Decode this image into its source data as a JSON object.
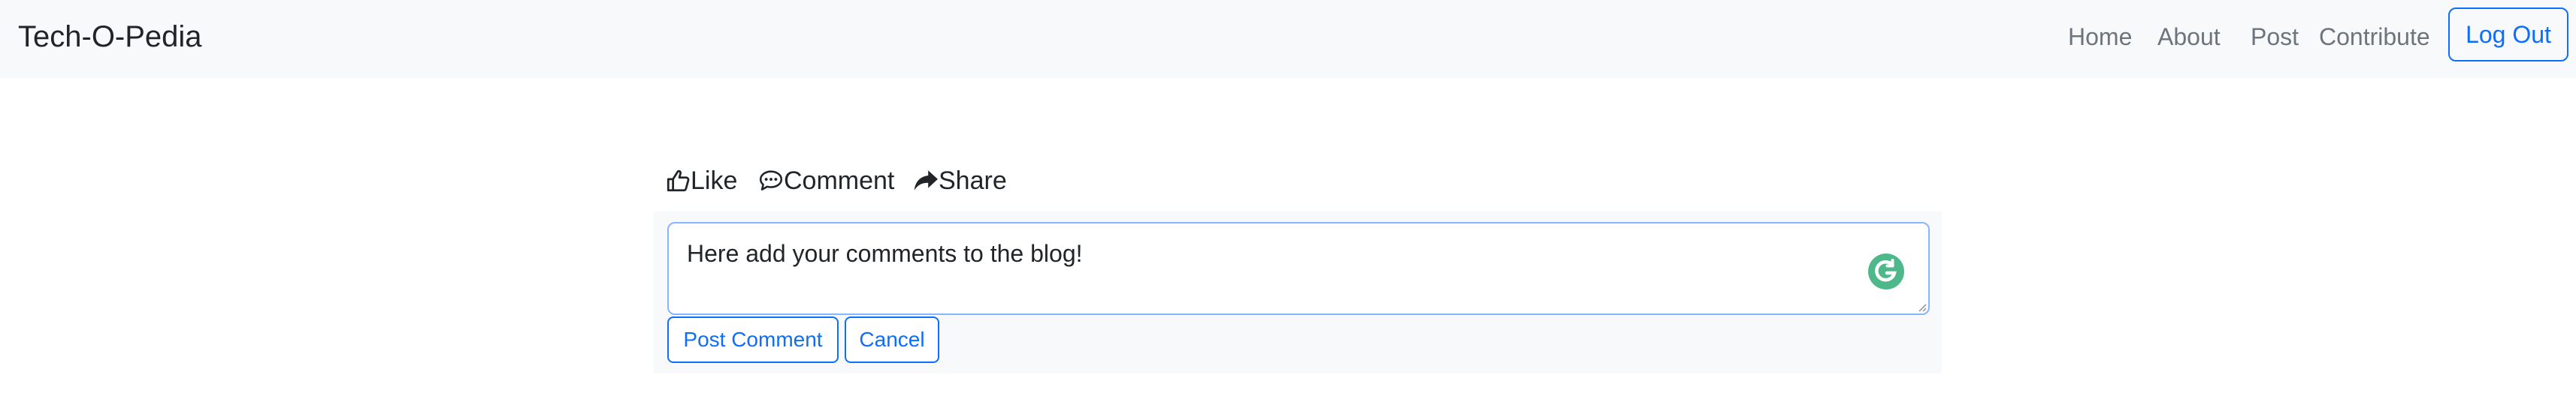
{
  "navbar": {
    "brand": "Tech-O-Pedia",
    "links": [
      "Home",
      "About",
      "Post",
      "Contribute"
    ],
    "logout_label": "Log Out"
  },
  "post_actions": {
    "like": {
      "label": "Like",
      "icon": "thumbs-up-icon"
    },
    "comment": {
      "label": "Comment",
      "icon": "chat-bubble-icon"
    },
    "share": {
      "label": "Share",
      "icon": "share-arrow-icon"
    }
  },
  "comment_form": {
    "input_text": "Here add your comments to the blog!",
    "post_label": "Post Comment",
    "cancel_label": "Cancel"
  },
  "colors": {
    "primary": "#0d6efd",
    "navbar_bg": "#f8f9fa",
    "nav_text": "#6c757d",
    "grammarly": "#4fb88b"
  }
}
